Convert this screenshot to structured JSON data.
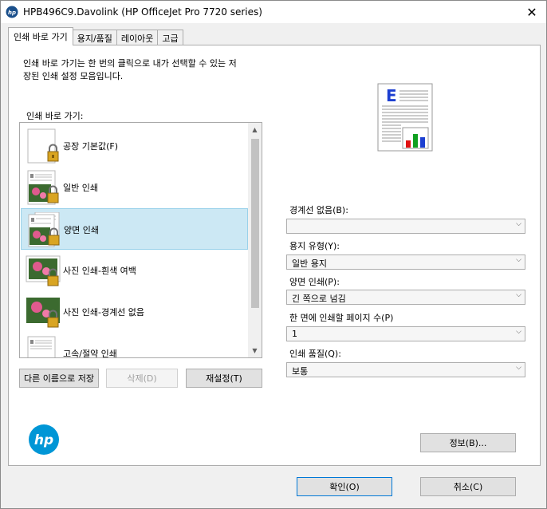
{
  "window": {
    "title": "HPB496C9.Davolink (HP OfficeJet Pro 7720 series)",
    "close_glyph": "✕"
  },
  "tabs": [
    {
      "label": "인쇄 바로 가기"
    },
    {
      "label": "용지/품질"
    },
    {
      "label": "레이아웃"
    },
    {
      "label": "고급"
    }
  ],
  "shortcuts": {
    "description_line1": "인쇄 바로 가기는 한 번의 클릭으로 내가 선택할 수 있는 저",
    "description_line2": "장된 인쇄 설정 모음입니다.",
    "list_label": "인쇄 바로 가기:",
    "items": [
      {
        "label": "공장 기본값(F)",
        "icon": "blank-page-lock-icon"
      },
      {
        "label": "일반 인쇄",
        "icon": "photo-doc-lock-icon"
      },
      {
        "label": "양면 인쇄",
        "icon": "duplex-doc-lock-icon",
        "selected": true
      },
      {
        "label": "사진 인쇄-흰색 여백",
        "icon": "photo-border-lock-icon"
      },
      {
        "label": "사진 인쇄-경계선 없음",
        "icon": "photo-borderless-lock-icon"
      },
      {
        "label": "고속/절약 인쇄",
        "icon": "doc-lock-icon"
      }
    ],
    "save_as_label": "다른 이름으로 저장",
    "delete_label": "삭제(D)",
    "reset_label": "재설정(T)"
  },
  "settings": {
    "borderless": {
      "label": "경계선 없음(B):",
      "value": ""
    },
    "paper_type": {
      "label": "용지 유형(Y):",
      "value": "일반 용지"
    },
    "duplex": {
      "label": "양면 인쇄(P):",
      "value": "긴 쪽으로 넘김"
    },
    "pages_per_sheet": {
      "label": "한 면에 인쇄할 페이지 수(P)",
      "value": "1"
    },
    "quality": {
      "label": "인쇄 품질(Q):",
      "value": "보통"
    }
  },
  "about_label": "정보(B)...",
  "ok_label": "확인(O)",
  "cancel_label": "취소(C)",
  "preview_letter": "E",
  "logo_text": "hp",
  "colors": {
    "accent": "#0078d7",
    "selection": "#cce8f4",
    "hp_blue": "#0096d6"
  }
}
